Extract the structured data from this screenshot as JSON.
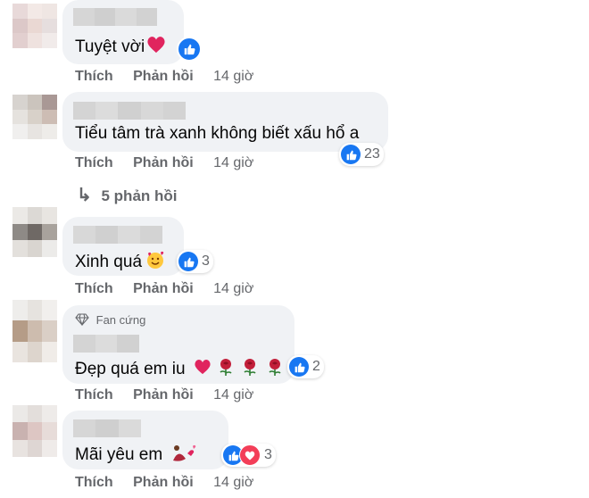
{
  "colors": {
    "bubble": "#f0f2f5",
    "like_blue": "#1877f2",
    "heart_red": "#f33e58",
    "muted_text": "#65676b"
  },
  "actions": {
    "like_label": "Thích",
    "reply_label": "Phản hồi"
  },
  "comments": [
    {
      "text": "Tuyệt vời",
      "time": "14 giờ",
      "reactions": [
        "like-icon"
      ],
      "reaction_count": ""
    },
    {
      "text": "Tiểu tâm trà xanh không biết xấu hổ a",
      "time": "14 giờ",
      "reactions": [
        "like-icon"
      ],
      "reaction_count": "23"
    },
    {
      "text": "Xinh quá",
      "time": "14 giờ",
      "reactions": [
        "like-icon"
      ],
      "reaction_count": "3"
    },
    {
      "badge": "Fan cứng",
      "text": "Đẹp quá em iu",
      "time": "14 giờ",
      "reactions": [
        "like-icon"
      ],
      "reaction_count": "2"
    },
    {
      "text": "Mãi yêu em",
      "time": "14 giờ",
      "reactions": [
        "like-icon",
        "love-icon"
      ],
      "reaction_count": "3"
    }
  ],
  "view_replies": {
    "arrow": "↳",
    "label": "5 phản hồi"
  }
}
